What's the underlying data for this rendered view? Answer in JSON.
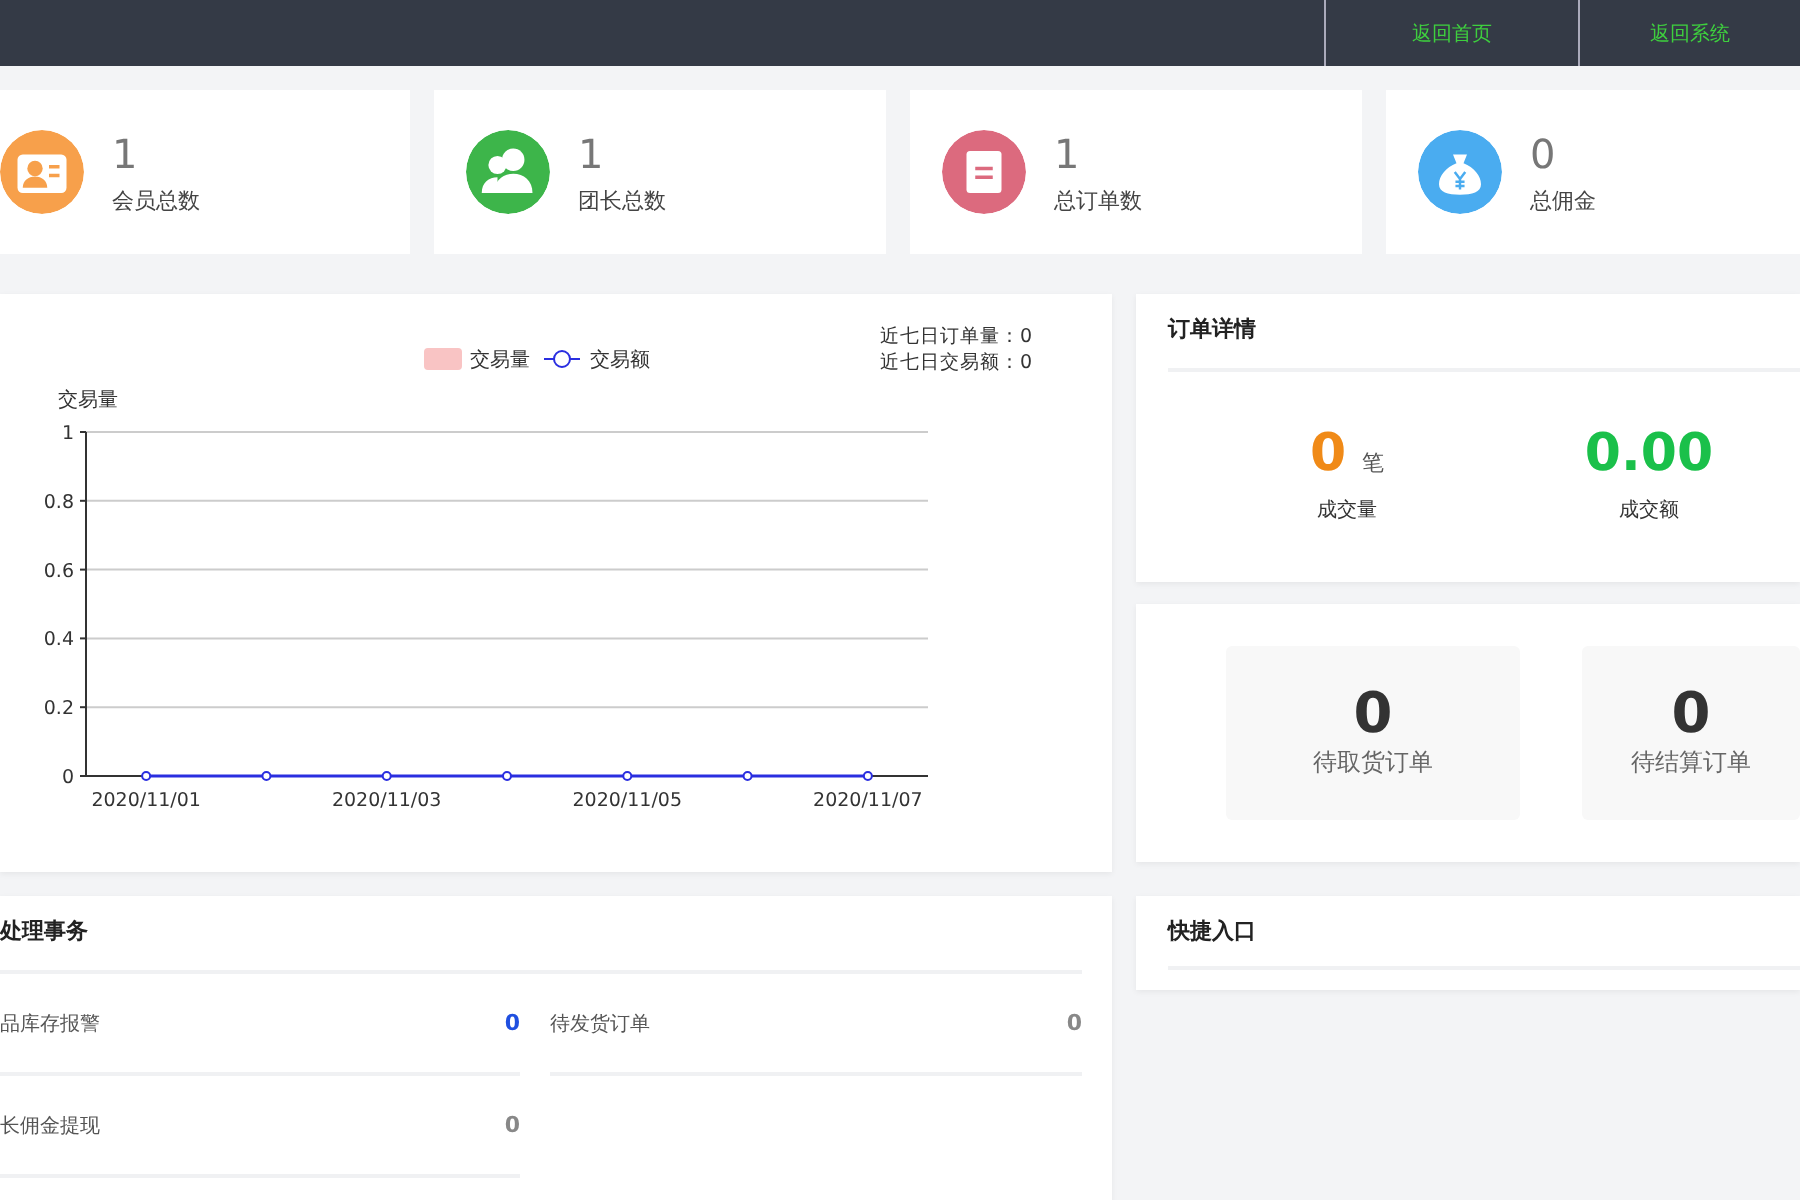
{
  "header": {
    "links": [
      {
        "label": "返回首页"
      },
      {
        "label": "返回系统"
      }
    ]
  },
  "stats": [
    {
      "kind": "member",
      "color": "#f7a04b",
      "value": "1",
      "label": "会员总数"
    },
    {
      "kind": "leader",
      "color": "#3db54a",
      "value": "1",
      "label": "团长总数"
    },
    {
      "kind": "order",
      "color": "#dc6a7e",
      "value": "1",
      "label": "总订单数"
    },
    {
      "kind": "money",
      "color": "#4aacf0",
      "value": "0",
      "label": "总佣金"
    }
  ],
  "trend": {
    "legend_swatch": {
      "label": "交易量",
      "color": "#f9c4c4"
    },
    "summary": [
      "近七日订单量：0",
      "近七日交易额：0"
    ],
    "chart_data": {
      "type": "line",
      "ylabel": "交易量",
      "categories": [
        "2020/11/01",
        null,
        "2020/11/03",
        null,
        "2020/11/05",
        null,
        "2020/11/07"
      ],
      "grid": true,
      "series": [
        {
          "name": "交易额",
          "color": "#2a2ee0",
          "marker": "circle",
          "values": [
            0,
            0,
            0,
            0,
            0,
            0,
            0
          ]
        }
      ],
      "ylim": [
        0,
        1
      ],
      "yticks": [
        0,
        0.2,
        0.4,
        0.6,
        0.8,
        1
      ]
    }
  },
  "order_details": {
    "title": "订单详情",
    "items": [
      {
        "value": "0",
        "unit": "笔",
        "label": "成交量",
        "color": "#f08a17"
      },
      {
        "value": "0.00",
        "label": "成交额",
        "color": "#1ac04a"
      }
    ]
  },
  "pending_orders": [
    {
      "value": "0",
      "label": "待取货订单"
    },
    {
      "value": "0",
      "label": "待结算订单"
    }
  ],
  "tasks": {
    "title": "处理事务",
    "items": [
      {
        "label": "品库存报警",
        "value": "0",
        "highlighted": true
      },
      {
        "label": "待发货订单",
        "value": "0",
        "highlighted": false
      },
      {
        "label": "长佣金提现",
        "value": "0",
        "highlighted": false
      }
    ]
  },
  "shortcuts": {
    "title": "快捷入口"
  }
}
